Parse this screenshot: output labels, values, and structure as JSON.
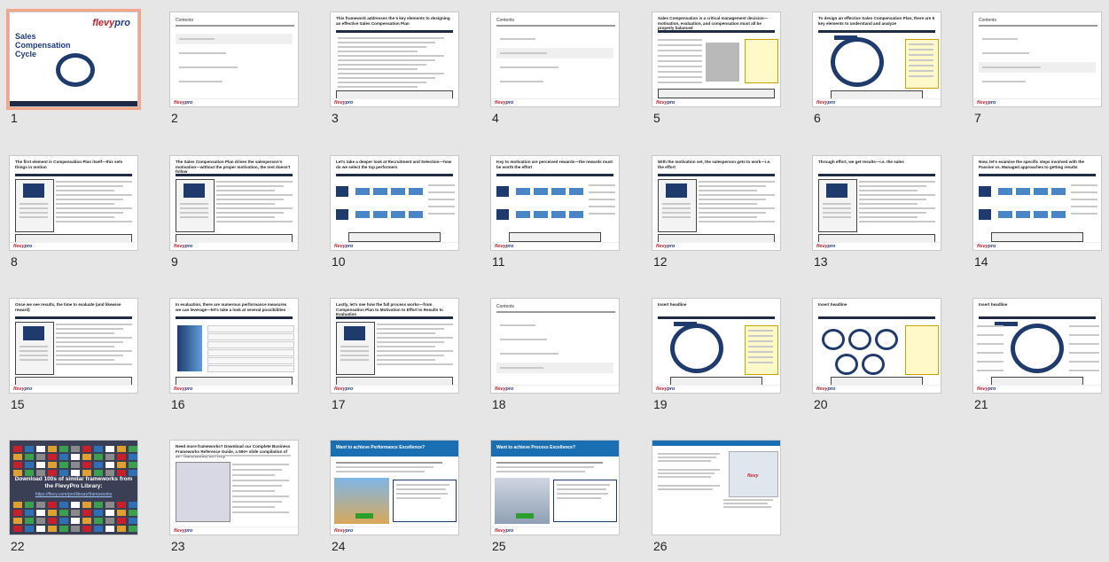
{
  "app": {
    "view": "Slide Sorter"
  },
  "brand": {
    "logo": "flevypro",
    "logo_left": "flevy",
    "logo_right": "pro"
  },
  "slides": [
    {
      "n": "1",
      "kind": "cover",
      "title": "Sales Compensation Cycle",
      "selected": true
    },
    {
      "n": "2",
      "kind": "contents",
      "title": "Contents"
    },
    {
      "n": "3",
      "kind": "text",
      "title": "This framework addresses the 5 key elements to designing an effective Sales Compensation Plan"
    },
    {
      "n": "4",
      "kind": "contents",
      "title": "Contents"
    },
    {
      "n": "5",
      "kind": "text-callout",
      "title": "Sales Compensation is a critical management decision—motivation, evaluation, and compensation must all be properly balanced"
    },
    {
      "n": "6",
      "kind": "cycle",
      "title": "To design an effective Sales Compensation Plan, there are 5 key elements to understand and analyze"
    },
    {
      "n": "7",
      "kind": "contents",
      "title": "Contents"
    },
    {
      "n": "8",
      "kind": "side-text",
      "title": "The first element is Compensation Plan itself—this sets things in motion"
    },
    {
      "n": "9",
      "kind": "side-text",
      "title": "The Sales Compensation Plan drives the salesperson's motivation—without the proper motivation, the rest doesn't follow"
    },
    {
      "n": "10",
      "kind": "flow",
      "title": "Let's take a deeper look at Recruitment and Selection—how do we select the top performers"
    },
    {
      "n": "11",
      "kind": "flow",
      "title": "Key to motivation are perceived rewards—the rewards must be worth the effort"
    },
    {
      "n": "12",
      "kind": "side-text",
      "title": "With the motivation set, the salesperson gets to work—i.e. the effort"
    },
    {
      "n": "13",
      "kind": "side-text",
      "title": "Through effort, we get results—i.e. the sales"
    },
    {
      "n": "14",
      "kind": "flow",
      "title": "Now, let's examine the specific steps involved with the Passive vs. Managed approaches to getting results"
    },
    {
      "n": "15",
      "kind": "side-text",
      "title": "Once we see results, the time to evaluate (and likewise reward)"
    },
    {
      "n": "16",
      "kind": "funnel",
      "title": "In evaluation, there are numerous performance measures we can leverage—let's take a look at several possibilities"
    },
    {
      "n": "17",
      "kind": "side-text",
      "title": "Lastly, let's see how the full process works—from Compensation Plan to Motivation to Effort to Results to Evaluation"
    },
    {
      "n": "18",
      "kind": "contents",
      "title": "Contents"
    },
    {
      "n": "19",
      "kind": "cycle",
      "title": "Insert headline"
    },
    {
      "n": "20",
      "kind": "rings",
      "title": "Insert headline"
    },
    {
      "n": "21",
      "kind": "cycle-labels",
      "title": "Insert headline"
    },
    {
      "n": "22",
      "kind": "library",
      "title": "Download 100s of similar frameworks from the FlevyPro Library:",
      "link": "https://flevy.com/pro/library/frameworks"
    },
    {
      "n": "23",
      "kind": "screenshot",
      "title": "Need more frameworks? Download our Complete Business Frameworks Reference Guide, a 550+ slide compilation of 50+ frameworks, on Flevy"
    },
    {
      "n": "24",
      "kind": "promo",
      "title": "Want to achieve Performance Excellence?"
    },
    {
      "n": "25",
      "kind": "promo",
      "title": "Want to achieve Process Excellence?"
    },
    {
      "n": "26",
      "kind": "end",
      "title": ""
    }
  ]
}
